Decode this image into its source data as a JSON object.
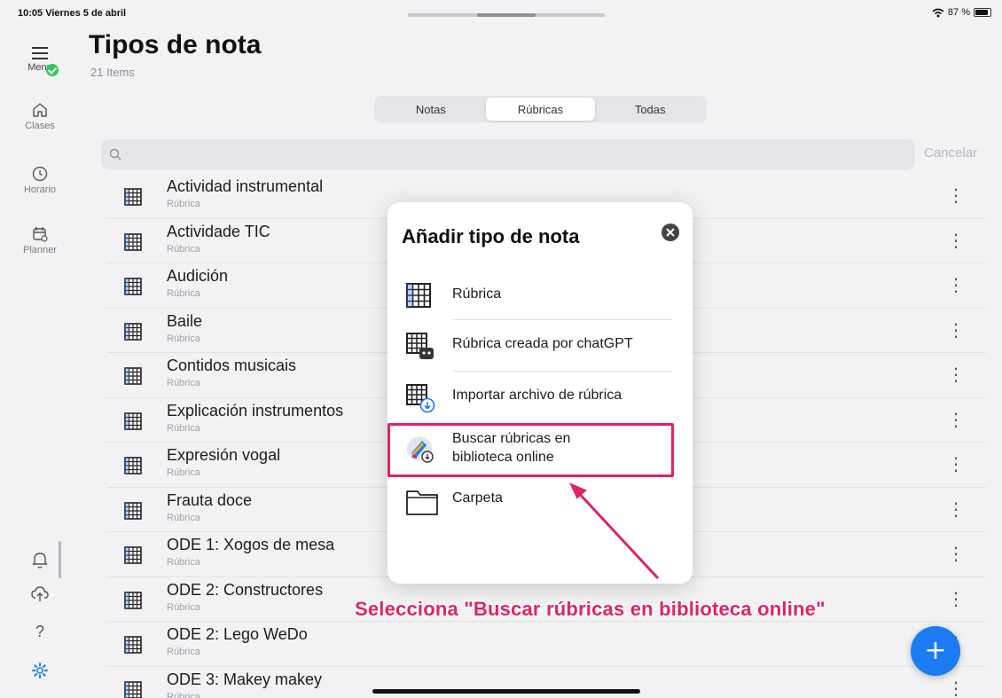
{
  "status": {
    "time": "10:05  Viernes 5 de abril",
    "battery": "87 %"
  },
  "sidebar": {
    "menu_label": "Menu",
    "items": [
      {
        "label": "Clases",
        "icon": "house-icon"
      },
      {
        "label": "Horario",
        "icon": "clock-icon"
      },
      {
        "label": "Planner",
        "icon": "planner-icon"
      }
    ],
    "bottom_icons": [
      "bell-icon",
      "cloud-upload-icon",
      "help-icon",
      "gear-icon"
    ]
  },
  "header": {
    "title": "Tipos de nota",
    "count": "21 Items"
  },
  "tabs": [
    {
      "label": "Notas",
      "active": false
    },
    {
      "label": "Rúbricas",
      "active": true
    },
    {
      "label": "Todas",
      "active": false
    }
  ],
  "search": {
    "placeholder": "",
    "value": "",
    "cancel_label": "Cancelar"
  },
  "list": [
    {
      "name": "Actividad instrumental",
      "type": "Rúbrica"
    },
    {
      "name": "Actividade TIC",
      "type": "Rúbrica"
    },
    {
      "name": "Audición",
      "type": "Rúbrica"
    },
    {
      "name": "Baile",
      "type": "Rúbrica"
    },
    {
      "name": "Contidos musicais",
      "type": "Rúbrica"
    },
    {
      "name": "Explicación instrumentos",
      "type": "Rúbrica"
    },
    {
      "name": "Expresión vogal",
      "type": "Rúbrica"
    },
    {
      "name": "Frauta doce",
      "type": "Rúbrica"
    },
    {
      "name": "ODE 1: Xogos de mesa",
      "type": "Rúbrica"
    },
    {
      "name": "ODE 2: Constructores",
      "type": "Rúbrica"
    },
    {
      "name": "ODE 2: Lego WeDo",
      "type": "Rúbrica"
    },
    {
      "name": "ODE 3: Makey makey",
      "type": "Rúbrica"
    }
  ],
  "popover": {
    "title": "Añadir tipo de nota",
    "options": [
      {
        "label": "Rúbrica",
        "icon": "grid-icon"
      },
      {
        "label": "Rúbrica creada por chatGPT",
        "icon": "grid-robot-icon"
      },
      {
        "label": "Importar archivo de rúbrica",
        "icon": "grid-import-icon"
      },
      {
        "label": "Buscar rúbricas en biblioteca online",
        "icon": "online-library-icon"
      },
      {
        "label": "Carpeta",
        "icon": "folder-icon"
      }
    ]
  },
  "annotation": "Selecciona \"Buscar rúbricas en biblioteca online\"",
  "colors": {
    "accent": "#1a7bf2",
    "highlight": "#e0245e",
    "badge": "#34c759"
  }
}
